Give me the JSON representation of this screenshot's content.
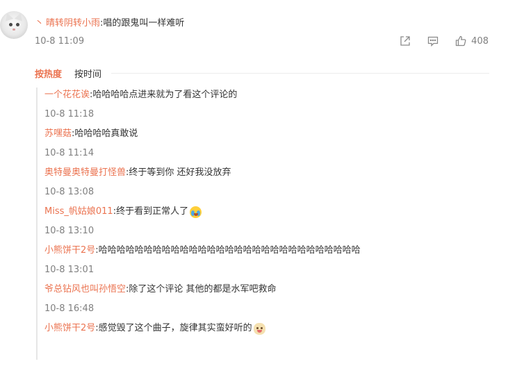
{
  "main_comment": {
    "bullet": "丶",
    "username": "晴转阴转小雨",
    "text": ":唱的跟鬼叫一样难听",
    "time": "10-8 11:09",
    "like_count": "408"
  },
  "sort": {
    "hot": "按热度",
    "time": "按时间"
  },
  "replies": [
    {
      "username": "一个花花诶",
      "text": ":哈哈哈哈点进来就为了看这个评论的",
      "time": "10-8 11:18",
      "emoji": null
    },
    {
      "username": "苏嘿菇",
      "text": ":哈哈哈哈真敢说",
      "time": "10-8 11:14",
      "emoji": null
    },
    {
      "username": "奥特曼奥特曼打怪兽",
      "text": ":终于等到你 还好我没放弃",
      "time": "10-8 13:08",
      "emoji": null
    },
    {
      "username": "Miss_帆姑娘011",
      "text": ":终于看到正常人了",
      "time": "10-8 13:10",
      "emoji": "laugh-cry-emoji"
    },
    {
      "username": "小熊饼干2号",
      "text": ":哈哈哈哈哈哈哈哈哈哈哈哈哈哈哈哈哈哈哈哈哈哈哈哈哈哈哈哈哈",
      "time": "10-8 13:01",
      "emoji": null
    },
    {
      "username": "爷总钻风也叫孙悟空",
      "text": ":除了这个评论 其他的都是水军吧救命",
      "time": "10-8 16:48",
      "emoji": null
    },
    {
      "username": "小熊饼干2号",
      "text": ":感觉毁了这个曲子，旋律其实蛮好听的",
      "time": "",
      "emoji": "cat-face-emoji"
    }
  ],
  "icons": {
    "share": "share-icon",
    "comment": "comment-icon",
    "like": "thumbs-up-icon"
  },
  "colors": {
    "username": "#eb7350",
    "text": "#333333",
    "meta": "#808080"
  }
}
